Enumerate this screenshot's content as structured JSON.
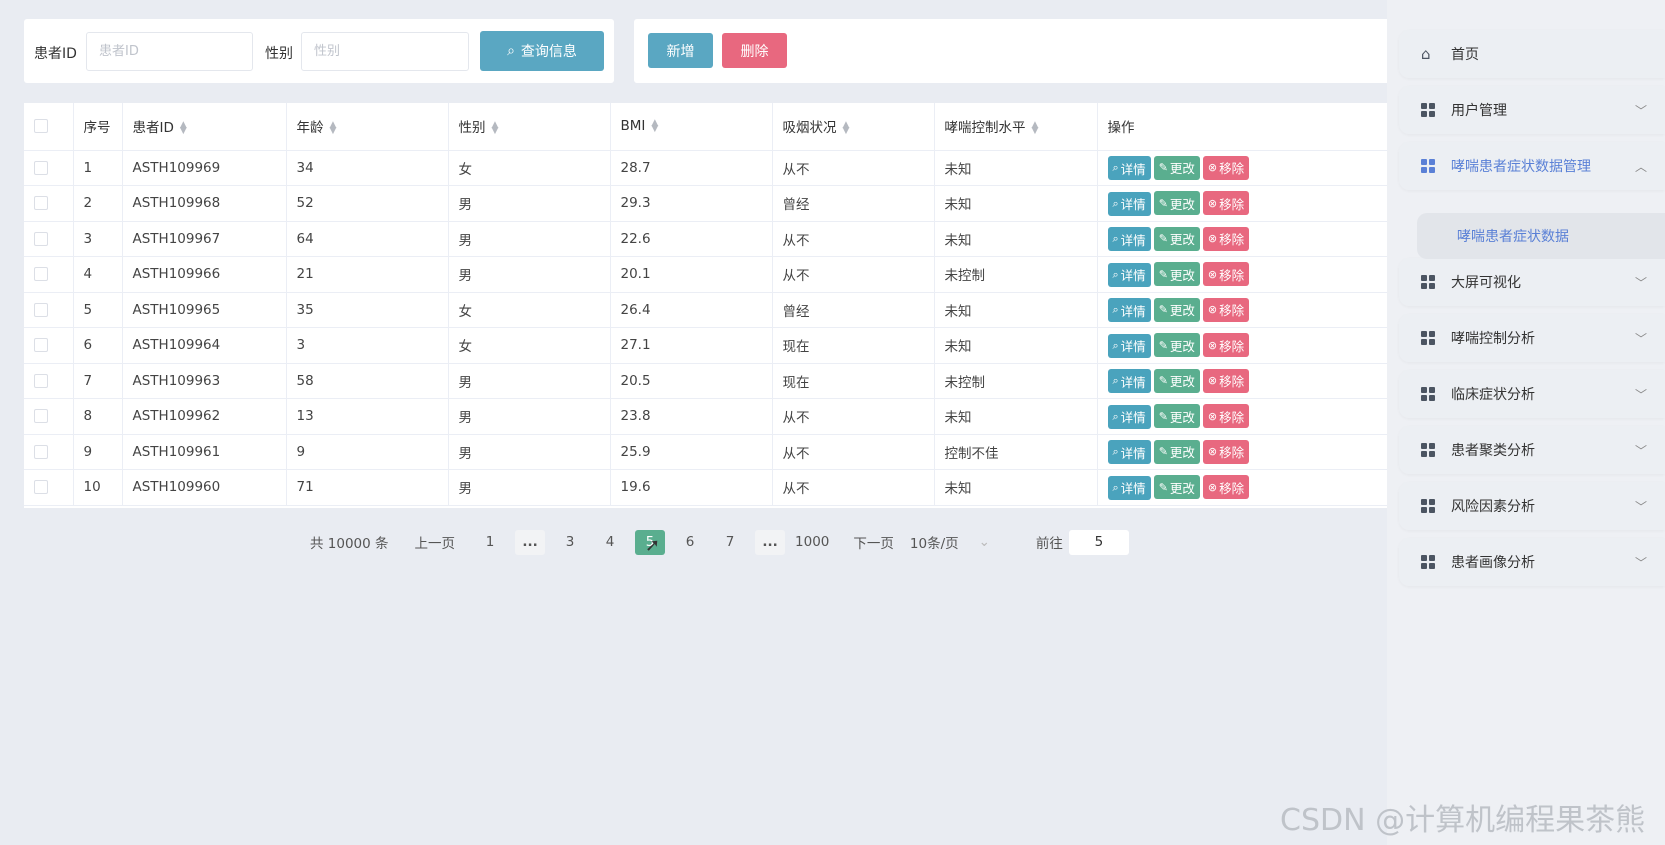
{
  "search": {
    "patient_id_label": "患者ID",
    "patient_id_placeholder": "患者ID",
    "gender_label": "性别",
    "gender_placeholder": "性别",
    "query_button": "查询信息"
  },
  "toolbar": {
    "add_label": "新增",
    "delete_label": "删除"
  },
  "table": {
    "headers": [
      "序号",
      "患者ID",
      "年龄",
      "性别",
      "BMI",
      "吸烟状况",
      "哮喘控制水平",
      "操作"
    ],
    "actions": {
      "detail": "详情",
      "edit": "更改",
      "remove": "移除"
    },
    "rows": [
      [
        "1",
        "ASTH109969",
        "34",
        "女",
        "28.7",
        "从不",
        "未知"
      ],
      [
        "2",
        "ASTH109968",
        "52",
        "男",
        "29.3",
        "曾经",
        "未知"
      ],
      [
        "3",
        "ASTH109967",
        "64",
        "男",
        "22.6",
        "从不",
        "未知"
      ],
      [
        "4",
        "ASTH109966",
        "21",
        "男",
        "20.1",
        "从不",
        "未控制"
      ],
      [
        "5",
        "ASTH109965",
        "35",
        "女",
        "26.4",
        "曾经",
        "未知"
      ],
      [
        "6",
        "ASTH109964",
        "3",
        "女",
        "27.1",
        "现在",
        "未知"
      ],
      [
        "7",
        "ASTH109963",
        "58",
        "男",
        "20.5",
        "现在",
        "未控制"
      ],
      [
        "8",
        "ASTH109962",
        "13",
        "男",
        "23.8",
        "从不",
        "未知"
      ],
      [
        "9",
        "ASTH109961",
        "9",
        "男",
        "25.9",
        "从不",
        "控制不佳"
      ],
      [
        "10",
        "ASTH109960",
        "71",
        "男",
        "19.6",
        "从不",
        "未知"
      ]
    ]
  },
  "pagination": {
    "total": "共 10000 条",
    "prev": "上一页",
    "pages": [
      "1",
      "...",
      "3",
      "4",
      "5",
      "6",
      "7",
      "...",
      "1000"
    ],
    "current": "5",
    "next": "下一页",
    "page_size": "10条/页",
    "goto_label": "前往",
    "goto_value": "5"
  },
  "sidebar": {
    "items": [
      {
        "label": "首页",
        "icon": "home-icon"
      },
      {
        "label": "用户管理",
        "icon": "grid-icon"
      },
      {
        "label": "哮喘患者症状数据管理",
        "icon": "grid-icon",
        "active": true
      },
      {
        "label": "大屏可视化",
        "icon": "grid-icon"
      },
      {
        "label": "哮喘控制分析",
        "icon": "grid-icon"
      },
      {
        "label": "临床症状分析",
        "icon": "grid-icon"
      },
      {
        "label": "患者聚类分析",
        "icon": "grid-icon"
      },
      {
        "label": "风险因素分析",
        "icon": "grid-icon"
      },
      {
        "label": "患者画像分析",
        "icon": "grid-icon"
      }
    ],
    "sub_item": "哮喘患者症状数据"
  },
  "watermark": "CSDN @计算机编程果茶熊",
  "colors": {
    "primary": "#5aa7c2",
    "danger": "#e8687f",
    "success": "#5aae8f",
    "active_menu": "#5a80d6"
  }
}
